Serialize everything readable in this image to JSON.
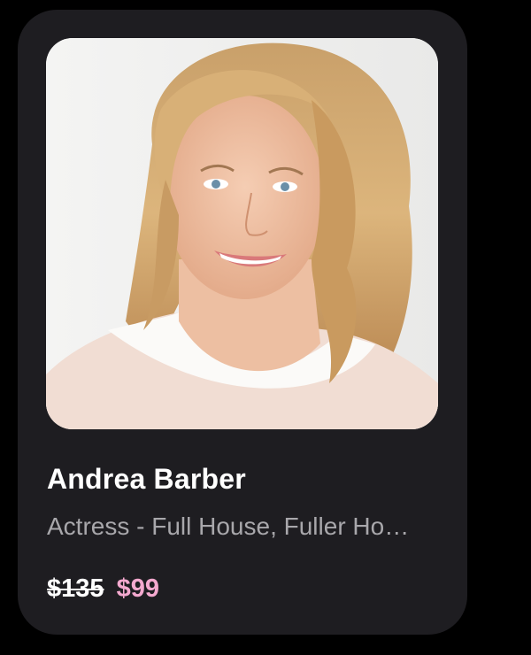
{
  "card": {
    "photo_alt": "Andrea Barber",
    "name": "Andrea Barber",
    "subtitle": "Actress - Full House, Fuller House",
    "original_price": "$135",
    "sale_price": "$99"
  },
  "colors": {
    "background": "#000000",
    "card": "#1e1d21",
    "name": "#ffffff",
    "subtitle": "#a8a7ab",
    "sale_price": "#f4a9cf"
  }
}
